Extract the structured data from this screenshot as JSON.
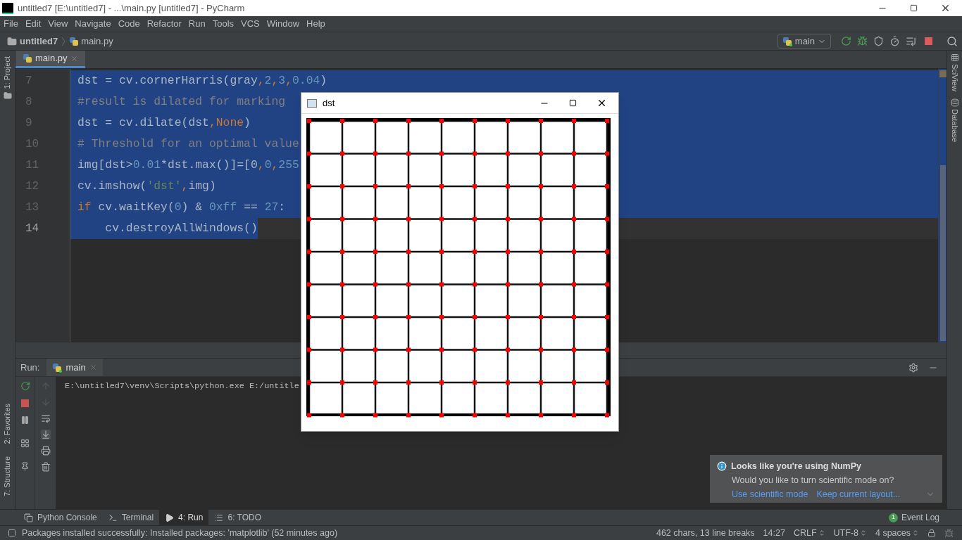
{
  "window": {
    "title": "untitled7 [E:\\untitled7] - ...\\main.py [untitled7] - PyCharm"
  },
  "menu": [
    "File",
    "Edit",
    "View",
    "Navigate",
    "Code",
    "Refactor",
    "Run",
    "Tools",
    "VCS",
    "Window",
    "Help"
  ],
  "breadcrumb": {
    "project": "untitled7",
    "file": "main.py"
  },
  "run_config": {
    "label": "main"
  },
  "left_tabs_top": [
    {
      "label": "1: Project"
    }
  ],
  "left_tabs_bottom": [
    {
      "label": "2: Favorites"
    },
    {
      "label": "7: Structure"
    }
  ],
  "right_tabs": [
    {
      "label": "SciView"
    },
    {
      "label": "Database"
    }
  ],
  "editor_tabs": [
    {
      "label": "main.py",
      "selected": true
    }
  ],
  "code_lines": [
    {
      "number": "7",
      "current": false,
      "selected": true,
      "tokens": [
        {
          "kind": "plain",
          "text": "dst = cv.cornerHarris(gray"
        },
        {
          "kind": "keyword",
          "text": ","
        },
        {
          "kind": "number",
          "text": "2"
        },
        {
          "kind": "keyword",
          "text": ","
        },
        {
          "kind": "number",
          "text": "3"
        },
        {
          "kind": "keyword",
          "text": ","
        },
        {
          "kind": "number",
          "text": "0.04"
        },
        {
          "kind": "plain",
          "text": ")"
        }
      ]
    },
    {
      "number": "8",
      "current": false,
      "selected": true,
      "tokens": [
        {
          "kind": "comment",
          "text": "#result is dilated for marking"
        }
      ]
    },
    {
      "number": "9",
      "current": false,
      "selected": true,
      "tokens": [
        {
          "kind": "plain",
          "text": "dst = cv.dilate(dst"
        },
        {
          "kind": "keyword",
          "text": ","
        },
        {
          "kind": "keyword",
          "text": "None"
        },
        {
          "kind": "plain",
          "text": ")"
        }
      ]
    },
    {
      "number": "10",
      "current": false,
      "selected": true,
      "tokens": [
        {
          "kind": "comment",
          "text": "# Threshold for an optimal value"
        }
      ]
    },
    {
      "number": "11",
      "current": false,
      "selected": true,
      "tokens": [
        {
          "kind": "plain",
          "text": "img[dst>"
        },
        {
          "kind": "number",
          "text": "0.01"
        },
        {
          "kind": "plain",
          "text": "*dst.max()]=[0"
        },
        {
          "kind": "keyword",
          "text": ","
        },
        {
          "kind": "number",
          "text": "0"
        },
        {
          "kind": "keyword",
          "text": ","
        },
        {
          "kind": "number",
          "text": "255"
        }
      ]
    },
    {
      "number": "12",
      "current": false,
      "selected": true,
      "tokens": [
        {
          "kind": "plain",
          "text": "cv.imshow("
        },
        {
          "kind": "string",
          "text": "'dst'"
        },
        {
          "kind": "keyword",
          "text": ","
        },
        {
          "kind": "plain",
          "text": "img)"
        }
      ]
    },
    {
      "number": "13",
      "current": false,
      "selected": true,
      "tokens": [
        {
          "kind": "keyword",
          "text": "if"
        },
        {
          "kind": "plain",
          "text": " cv.waitKey("
        },
        {
          "kind": "number",
          "text": "0"
        },
        {
          "kind": "plain",
          "text": ") & "
        },
        {
          "kind": "number",
          "text": "0xff"
        },
        {
          "kind": "plain",
          "text": " == "
        },
        {
          "kind": "number",
          "text": "27"
        },
        {
          "kind": "plain",
          "text": ":"
        }
      ]
    },
    {
      "number": "14",
      "current": true,
      "selected": true,
      "tokens": [
        {
          "kind": "plain",
          "text": "    cv.destroyAllWindows()"
        }
      ]
    }
  ],
  "run_panel": {
    "label": "Run:",
    "tabs": [
      {
        "label": "main",
        "selected": true
      }
    ],
    "console": [
      "E:\\untitled7\\venv\\Scripts\\python.exe E:/untitle"
    ]
  },
  "image_window": {
    "title": "dst"
  },
  "notification": {
    "title": "Looks like you're using NumPy",
    "body": "Would you like to turn scientific mode on?",
    "links": [
      "Use scientific mode",
      "Keep current layout..."
    ]
  },
  "bottom_tabs": [
    {
      "label": "Python Console",
      "selected": false,
      "kind": "console"
    },
    {
      "label": "Terminal",
      "selected": false,
      "kind": "terminal"
    },
    {
      "label": "4: Run",
      "selected": true,
      "kind": "run"
    },
    {
      "label": "6: TODO",
      "selected": false,
      "kind": "todo"
    }
  ],
  "event_log": {
    "label": "Event Log",
    "count": "1"
  },
  "status_bar": {
    "message": "Packages installed successfully: Installed packages: 'matplotlib' (52 minutes ago)",
    "items": [
      "462 chars, 13 line breaks",
      "14:27",
      "CRLF",
      "UTF-8",
      "4 spaces"
    ]
  }
}
